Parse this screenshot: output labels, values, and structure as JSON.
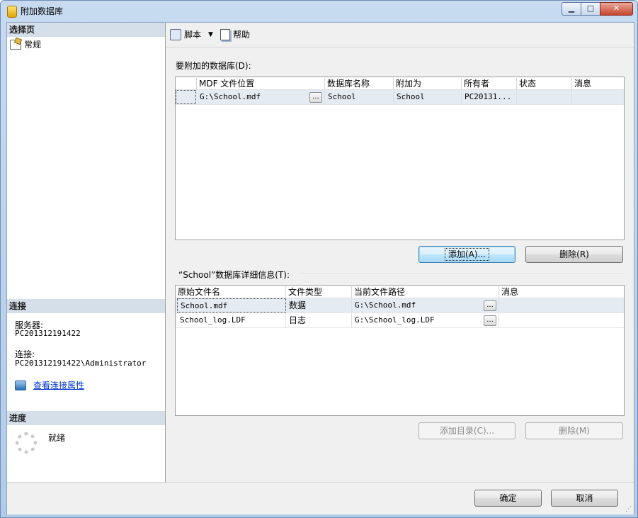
{
  "window": {
    "title": "附加数据库",
    "controls": {
      "minimize": "▁",
      "maximize": "□",
      "close": "✕"
    }
  },
  "sidebar": {
    "select_page_header": "选择页",
    "pages": [
      {
        "label": "常规",
        "icon": "general-page-icon"
      }
    ],
    "connection_header": "连接",
    "server_label": "服务器:",
    "server_value": "PC201312191422",
    "connection_label": "连接:",
    "connection_value": "PC201312191422\\Administrator",
    "view_connection_properties": "查看连接属性",
    "progress_header": "进度",
    "progress_status": "就绪"
  },
  "toolbar": {
    "script_label": "脚本",
    "script_dropdown": "▼",
    "help_label": "帮助"
  },
  "attach_grid": {
    "label": "要附加的数据库(D):",
    "columns": [
      "MDF 文件位置",
      "数据库名称",
      "附加为",
      "所有者",
      "状态",
      "消息"
    ],
    "rows": [
      {
        "mdf": "G:\\School.mdf",
        "browse": "...",
        "db_name": "School",
        "attach_as": "School",
        "owner": "PC20131...",
        "status": "",
        "message": ""
      }
    ],
    "add_button": "添加(A)...",
    "remove_button": "删除(R)"
  },
  "details_grid": {
    "label": "“School”数据库详细信息(T):",
    "columns": [
      "原始文件名",
      "文件类型",
      "当前文件路径",
      "消息"
    ],
    "rows": [
      {
        "original": "School.mdf",
        "type": "数据",
        "path": "G:\\School.mdf",
        "browse": "...",
        "message": ""
      },
      {
        "original": "School_log.LDF",
        "type": "日志",
        "path": "G:\\School_log.LDF",
        "browse": "...",
        "message": ""
      }
    ],
    "add_catalog_button": "添加目录(C)...",
    "remove_button": "删除(M)"
  },
  "footer": {
    "ok_button": "确定",
    "cancel_button": "取消"
  }
}
